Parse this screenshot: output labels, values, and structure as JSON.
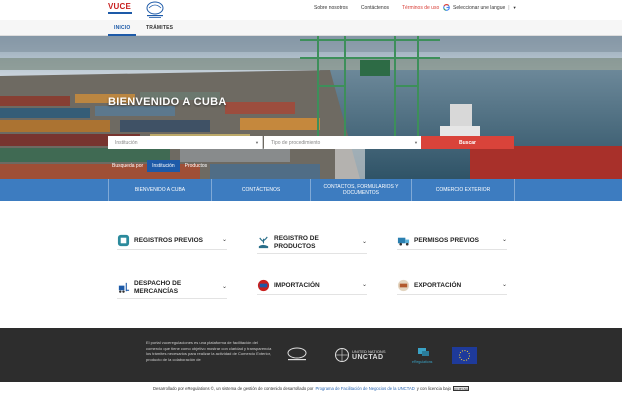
{
  "topbar": {
    "logo_text": "VUCE",
    "links": [
      "Sobre nosotros",
      "Contáctenos",
      "Términos de uso"
    ],
    "language_label": "Seleccionar une langue",
    "colors": {
      "accent": "#d83c35",
      "brand": "#1d5aa8"
    }
  },
  "nav": {
    "tabs": [
      "INICIO",
      "TRÁMITES"
    ]
  },
  "hero": {
    "title": "BIENVENIDO A CUBA",
    "search": {
      "label": "Busqueda por",
      "tab_institution": "Institución",
      "tab_products": "Productos",
      "institution_placeholder": "Institución",
      "procedure_placeholder": "Tipo de procedimiento",
      "button": "Buscar"
    }
  },
  "band": {
    "items": [
      "BIENVENIDO A CUBA",
      "CONTÁCTENOS",
      "CONTACTOS, FORMULARIOS Y DOCUMENTOS",
      "COMERCIO EXTERIOR"
    ]
  },
  "cards": [
    {
      "label": "REGISTROS PREVIOS",
      "icon": "certificate-icon"
    },
    {
      "label": "REGISTRO DE PRODUCTOS",
      "icon": "hand-plant-icon"
    },
    {
      "label": "PERMISOS PREVIOS",
      "icon": "truck-icon"
    },
    {
      "label": "DESPACHO DE MERCANCÍAS",
      "icon": "forklift-icon"
    },
    {
      "label": "IMPORTACIÓN",
      "icon": "import-badge-icon"
    },
    {
      "label": "EXPORTACIÓN",
      "icon": "export-badge-icon"
    }
  ],
  "footer": {
    "text": "El portal vuceregulaciones es una plataforma de facilitación del comercio que tiene como objetivo mostrar con claridad y transparencia los trámites necesarios para realizar la actividad de Comercio Exterior, producto de la colaboración de",
    "unctad_line1": "UNITED NATIONS",
    "unctad_line2": "UNCTAD",
    "eregulations": "eRegulations"
  },
  "credits": {
    "prefix": "Desarrollado por eRegulations ©, un sistema de gestión de contenido desarrollado por",
    "link": "Programa de Facilitación de Negocios de la UNCTAD",
    "suffix": "y con licencia bajo",
    "license": "CC BY-SA"
  }
}
